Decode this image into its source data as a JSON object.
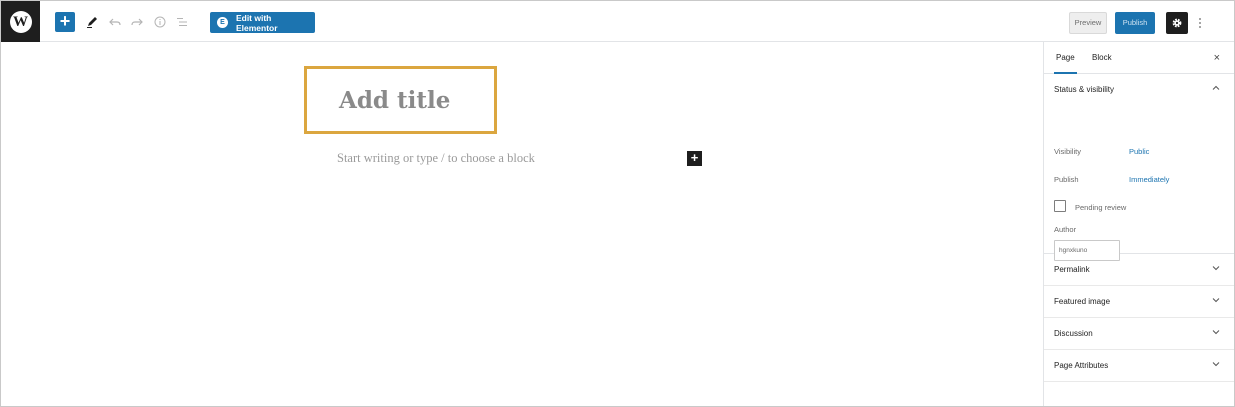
{
  "toolbar": {
    "wp_logo_letter": "W",
    "add_block_symbol": "+",
    "elementor_badge": "E",
    "elementor_label": "Edit with Elementor",
    "preview_label": "Preview",
    "publish_label": "Publish"
  },
  "editor": {
    "title_placeholder": "Add title",
    "block_placeholder": "Start writing or type / to choose a block",
    "inline_add_symbol": "+"
  },
  "sidebar": {
    "tabs": [
      {
        "label": "Page",
        "active": true
      },
      {
        "label": "Block",
        "active": false
      }
    ],
    "close_symbol": "×",
    "status_visibility": {
      "title": "Status & visibility",
      "visibility_label": "Visibility",
      "visibility_value": "Public",
      "publish_label": "Publish",
      "publish_value": "Immediately",
      "pending_review_label": "Pending review",
      "author_label": "Author",
      "author_value": "hgnxkuno"
    },
    "panels": [
      {
        "title": "Permalink"
      },
      {
        "title": "Featured image"
      },
      {
        "title": "Discussion"
      },
      {
        "title": "Page Attributes"
      }
    ]
  },
  "icons": {
    "undo": "undo-icon",
    "redo": "redo-icon",
    "info": "info-icon",
    "outline": "list-outline-icon",
    "tools": "pen-tool-icon",
    "settings": "gear-icon",
    "more": "more-vertical-icon"
  },
  "colors": {
    "accent": "#1c74b0",
    "title_highlight": "#dba63f",
    "dark": "#1e1e1e"
  }
}
